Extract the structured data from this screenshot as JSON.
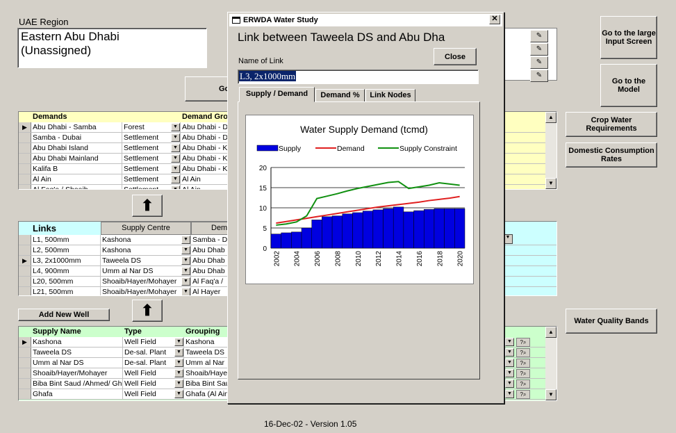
{
  "region": {
    "label": "UAE Region",
    "value_line1": "Eastern Abu Dhabi",
    "value_line2": "(Unassigned)"
  },
  "buttons": {
    "go_partial": "Go",
    "go_large_input": "Go to the large Input Screen",
    "go_model": "Go to the Model",
    "crop_water": "Crop Water Requirements",
    "domestic": "Domestic Consumption Rates",
    "water_quality": "Water Quality Bands",
    "add_new_well": "Add New Well"
  },
  "demands": {
    "headers": [
      "Demands",
      "",
      "Demand Gro"
    ],
    "rows": [
      {
        "name": "Abu Dhabi - Samba",
        "type": "Forest",
        "group": "Abu Dhabi - D",
        "current": true
      },
      {
        "name": "Samba - Dubai",
        "type": "Settlement",
        "group": "Abu Dhabi - D",
        "current": false
      },
      {
        "name": "Abu Dhabi Island",
        "type": "Settlement",
        "group": "Abu Dhabi - K",
        "current": false
      },
      {
        "name": "Abu Dhabi Mainland",
        "type": "Settlement",
        "group": "Abu Dhabi - K",
        "current": false
      },
      {
        "name": "Kalifa B",
        "type": "Settlement",
        "group": "Abu Dhabi - K",
        "current": false
      },
      {
        "name": "Al Ain",
        "type": "Settlement",
        "group": "Al Ain",
        "current": false
      },
      {
        "name": "Al Faq'a / Shoaib",
        "type": "Settlement",
        "group": "Al Ain",
        "current": false
      }
    ]
  },
  "links": {
    "headers": [
      "Links",
      "Supply Centre",
      "Dem"
    ],
    "rows": [
      {
        "name": "L1, 500mm",
        "centre": "Kashona",
        "dem": "Samba - D",
        "current": false
      },
      {
        "name": "L2, 500mm",
        "centre": "Kashona",
        "dem": "Abu Dhab",
        "current": false
      },
      {
        "name": "L3, 2x1000mm",
        "centre": "Taweela DS",
        "dem": "Abu Dhab",
        "current": true
      },
      {
        "name": "L4, 900mm",
        "centre": "Umm al Nar DS",
        "dem": "Abu Dhab",
        "current": false
      },
      {
        "name": "L20, 500mm",
        "centre": "Shoaib/Hayer/Mohayer",
        "dem": "Al Faq'a /",
        "current": false
      },
      {
        "name": "L21, 500mm",
        "centre": "Shoaib/Hayer/Mohayer",
        "dem": "Al Hayer",
        "current": false
      }
    ]
  },
  "supply": {
    "headers": [
      "Supply Name",
      "Type",
      "Grouping"
    ],
    "rows": [
      {
        "name": "Kashona",
        "type": "Well Field",
        "group": "Kashona",
        "current": true
      },
      {
        "name": "Taweela DS",
        "type": "De-sal. Plant",
        "group": "Taweela DS",
        "current": false
      },
      {
        "name": "Umm al Nar DS",
        "type": "De-sal. Plant",
        "group": "Umm al Nar",
        "current": false
      },
      {
        "name": "Shoaib/Hayer/Mohayer",
        "type": "Well Field",
        "group": "Shoaib/Haye",
        "current": false
      },
      {
        "name": "Biba Bint Saud /Ahmed/ Gh",
        "type": "Well Field",
        "group": "Biba Bint Sau",
        "current": false
      },
      {
        "name": "Ghafa",
        "type": "Well Field",
        "group": "Ghafa (Al Ain",
        "current": false
      }
    ]
  },
  "footer": {
    "version": "16-Dec-02 - Version 1.05"
  },
  "dialog": {
    "title": "ERWDA Water Study",
    "heading": "Link between Taweela DS and Abu Dha",
    "name_label": "Name of Link",
    "name_value": "L3, 2x1000mm",
    "close_label": "Close",
    "tabs": [
      "Supply / Demand",
      "Demand %",
      "Link Nodes"
    ],
    "active_tab": 0
  },
  "colors": {
    "supply": "#0000e0",
    "demand": "#e02020",
    "constraint": "#109010",
    "highlight": "#0a246a",
    "yellow": "#ffffc0",
    "cyan": "#ccffff",
    "green": "#ccffcc"
  },
  "chart_data": {
    "type": "bar",
    "title": "Water Supply Demand (tcmd)",
    "x": [
      2002,
      2003,
      2004,
      2005,
      2006,
      2007,
      2008,
      2009,
      2010,
      2011,
      2012,
      2013,
      2014,
      2015,
      2016,
      2017,
      2018,
      2019,
      2020
    ],
    "x_tick_labels": [
      "2002",
      "2004",
      "2006",
      "2008",
      "2010",
      "2012",
      "2014",
      "2016",
      "2018",
      "2020"
    ],
    "ylim": [
      0,
      20
    ],
    "y_ticks": [
      0,
      5,
      10,
      15,
      20
    ],
    "series": [
      {
        "name": "Supply",
        "kind": "bar",
        "values": [
          3.5,
          3.8,
          4.0,
          5.0,
          7.0,
          7.8,
          8.0,
          8.5,
          8.8,
          9.2,
          9.5,
          9.8,
          10.2,
          9.0,
          9.3,
          9.6,
          9.8,
          9.8,
          9.8
        ]
      },
      {
        "name": "Demand",
        "kind": "line",
        "values": [
          6.2,
          6.6,
          7.0,
          7.4,
          7.8,
          8.2,
          8.6,
          9.0,
          9.4,
          9.8,
          10.2,
          10.5,
          10.8,
          11.1,
          11.4,
          11.8,
          12.1,
          12.4,
          12.8
        ]
      },
      {
        "name": "Supply Constraint",
        "kind": "line",
        "values": [
          5.7,
          6.0,
          6.5,
          8.0,
          12.3,
          12.9,
          13.5,
          14.2,
          14.8,
          15.3,
          15.8,
          16.3,
          16.5,
          14.8,
          15.2,
          15.6,
          16.2,
          15.9,
          15.6
        ]
      }
    ],
    "legend": "top",
    "grid": true
  }
}
